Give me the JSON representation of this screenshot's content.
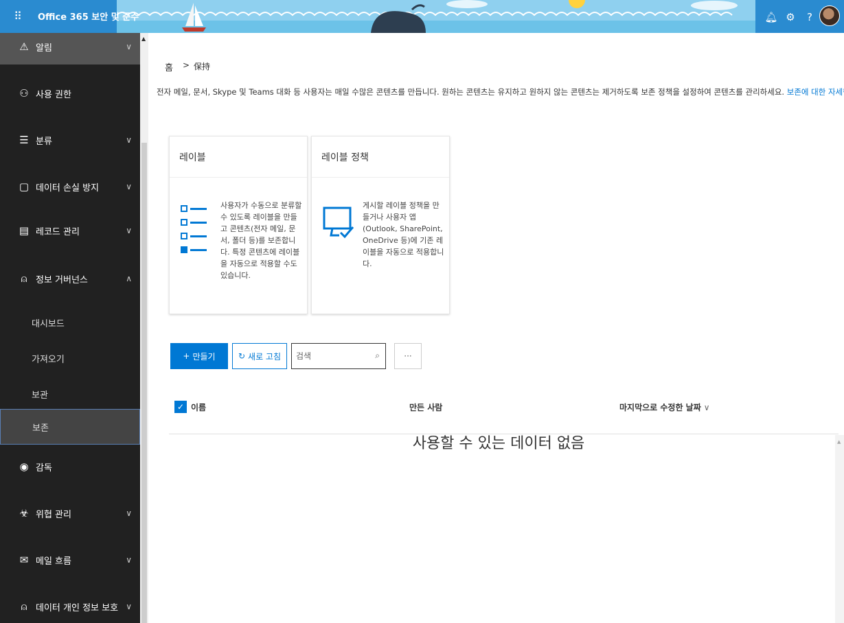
{
  "header": {
    "app_title": "Office 365 보안 및 준수",
    "waffle_icon": "waffle-icon",
    "icons": [
      "bell-icon",
      "gear-icon",
      "help-icon"
    ],
    "accent": "#2a8bd0"
  },
  "sidebar": {
    "items": [
      {
        "label": "알림",
        "icon": "warning-icon",
        "expandable": true,
        "expanded": false
      },
      {
        "label": "사용 권한",
        "icon": "people-icon",
        "expandable": false
      },
      {
        "label": "분류",
        "icon": "list-icon",
        "expandable": true,
        "expanded": false
      },
      {
        "label": "데이터 손실 방지",
        "icon": "document-lock-icon",
        "expandable": true,
        "expanded": false
      },
      {
        "label": "레코드 관리",
        "icon": "chart-doc-icon",
        "expandable": true,
        "expanded": false
      },
      {
        "label": "정보 거버넌스",
        "icon": "lock-icon",
        "expandable": true,
        "expanded": true
      },
      {
        "label": "감독",
        "icon": "eye-icon",
        "expandable": false
      },
      {
        "label": "위협 관리",
        "icon": "biohazard-icon",
        "expandable": true,
        "expanded": false
      },
      {
        "label": "메일 흐름",
        "icon": "mail-icon",
        "expandable": true,
        "expanded": false
      },
      {
        "label": "데이터 개인 정보 보호",
        "icon": "lock-icon",
        "expandable": true,
        "expanded": false
      }
    ],
    "sub_items": [
      "대시보드",
      "가져오기",
      "보관",
      "보존"
    ],
    "active_sub": "보존"
  },
  "breadcrumb": {
    "home": "홈",
    "separator": ">",
    "current": "保持"
  },
  "description": {
    "text": "전자 메일, 문서, Skype 및 Teams 대화 등 사용자는 매일 수많은 콘텐츠를 만듭니다. 원하는 콘텐츠는 유지하고 원하지 않는 콘텐츠는 제거하도록 보존 정책을 설정하여 콘텐츠를 관리하세요.",
    "link": "보존에 대한 자세한 정보"
  },
  "cards": [
    {
      "title": "레이블",
      "icon": "list-icon",
      "text": "사용자가 수동으로 분류할 수 있도록 레이블을 만들고 콘텐츠(전자 메일, 문서, 폴더 등)를 보존합니다. 특정 콘텐츠에 레이블을 자동으로 적용할 수도 있습니다."
    },
    {
      "title": "레이블 정책",
      "icon": "monitor-check-icon",
      "text": "게시할 레이블 정책을 만들거나 사용자 앱(Outlook, SharePoint, OneDrive 등)에 기존 레이블을 자동으로 적용합니다."
    }
  ],
  "toolbar": {
    "create_label": "만들기",
    "refresh_label": "새로 고침",
    "search_placeholder": "검색",
    "more_label": "···"
  },
  "list": {
    "columns": [
      "이름",
      "만든 사람",
      "마지막으로 수정한 날짜"
    ],
    "empty_message": "사용할 수 있는 데이터 없음",
    "rows": []
  }
}
